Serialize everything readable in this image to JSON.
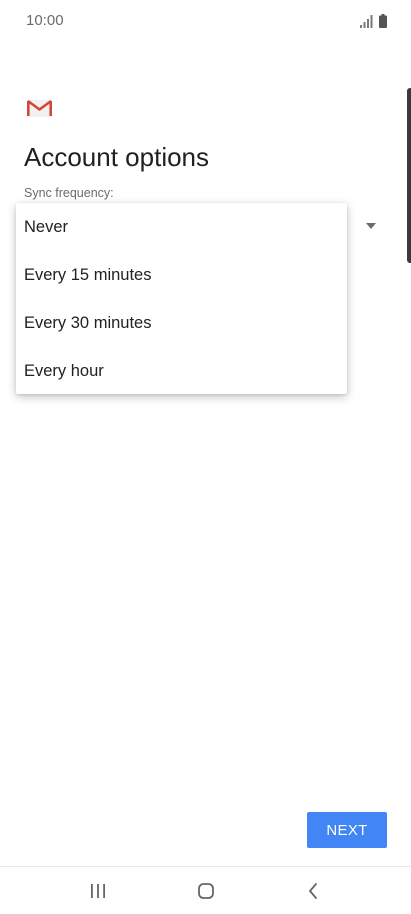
{
  "status_bar": {
    "time": "10:00",
    "icons": [
      "signal-icon",
      "battery-icon"
    ]
  },
  "app": {
    "logo_icon": "gmail-logo-icon",
    "brand_color": "#D44638"
  },
  "page": {
    "title": "Account options",
    "sync_label": "Sync frequency:"
  },
  "dropdown": {
    "options": [
      {
        "label": "Never"
      },
      {
        "label": "Every 15 minutes"
      },
      {
        "label": "Every 30 minutes"
      },
      {
        "label": "Every hour"
      }
    ]
  },
  "footer": {
    "next_label": "NEXT",
    "accent_color": "#4285F4"
  },
  "nav_bar": {
    "icons": [
      "recents-icon",
      "home-icon",
      "back-icon"
    ]
  }
}
